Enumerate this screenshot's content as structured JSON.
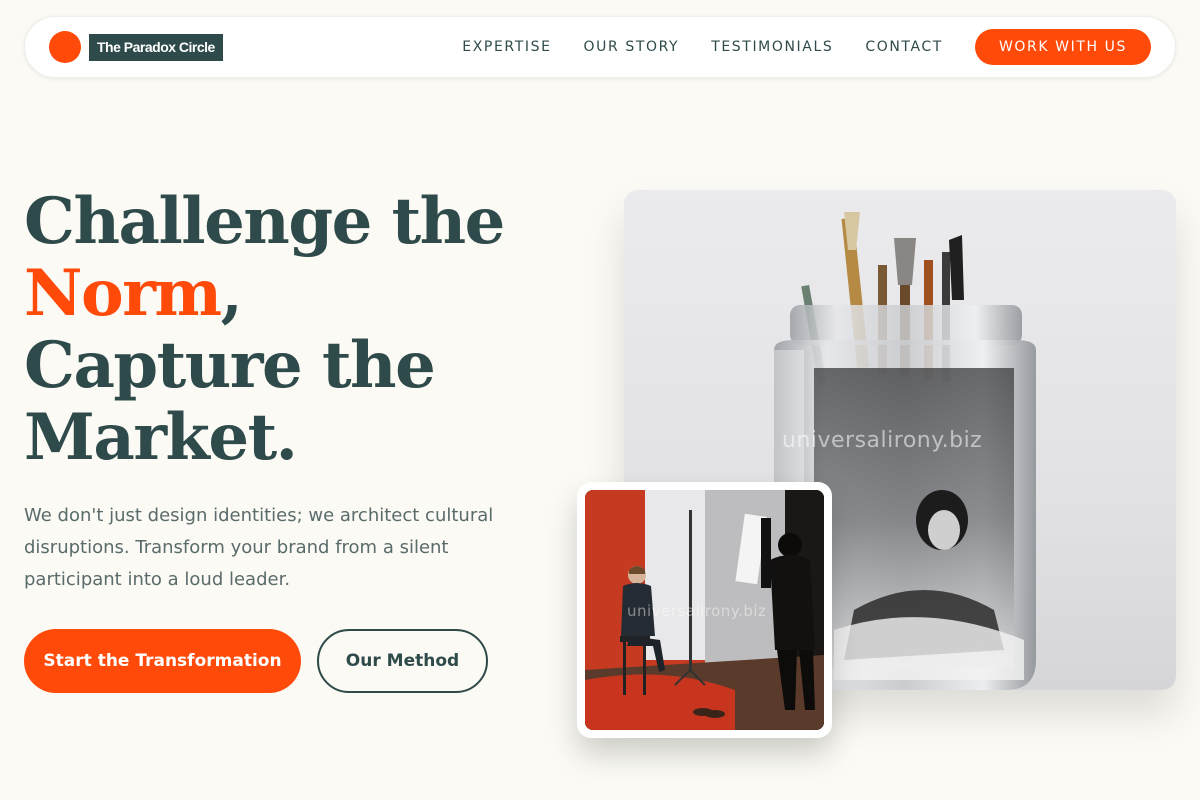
{
  "brand": {
    "name": "The Paradox Circle",
    "accent_color": "#ff4a0a",
    "dark_color": "#2f4a4a"
  },
  "nav": {
    "links": [
      "EXPERTISE",
      "OUR STORY",
      "TESTIMONIALS",
      "CONTACT"
    ],
    "cta": "WORK WITH US"
  },
  "hero": {
    "headline_part1": "Challenge the",
    "headline_accent": "Norm",
    "headline_comma": ",",
    "headline_line3": "Capture the",
    "headline_line4": "Market.",
    "subtext": "We don't just design identities; we architect cultural disruptions. Transform your brand from a silent participant into a loud leader.",
    "primary_button": "Start the Transformation",
    "secondary_button": "Our Method"
  },
  "images": {
    "main_watermark": "universalirony.biz",
    "card_watermark": "universalirony.biz"
  }
}
